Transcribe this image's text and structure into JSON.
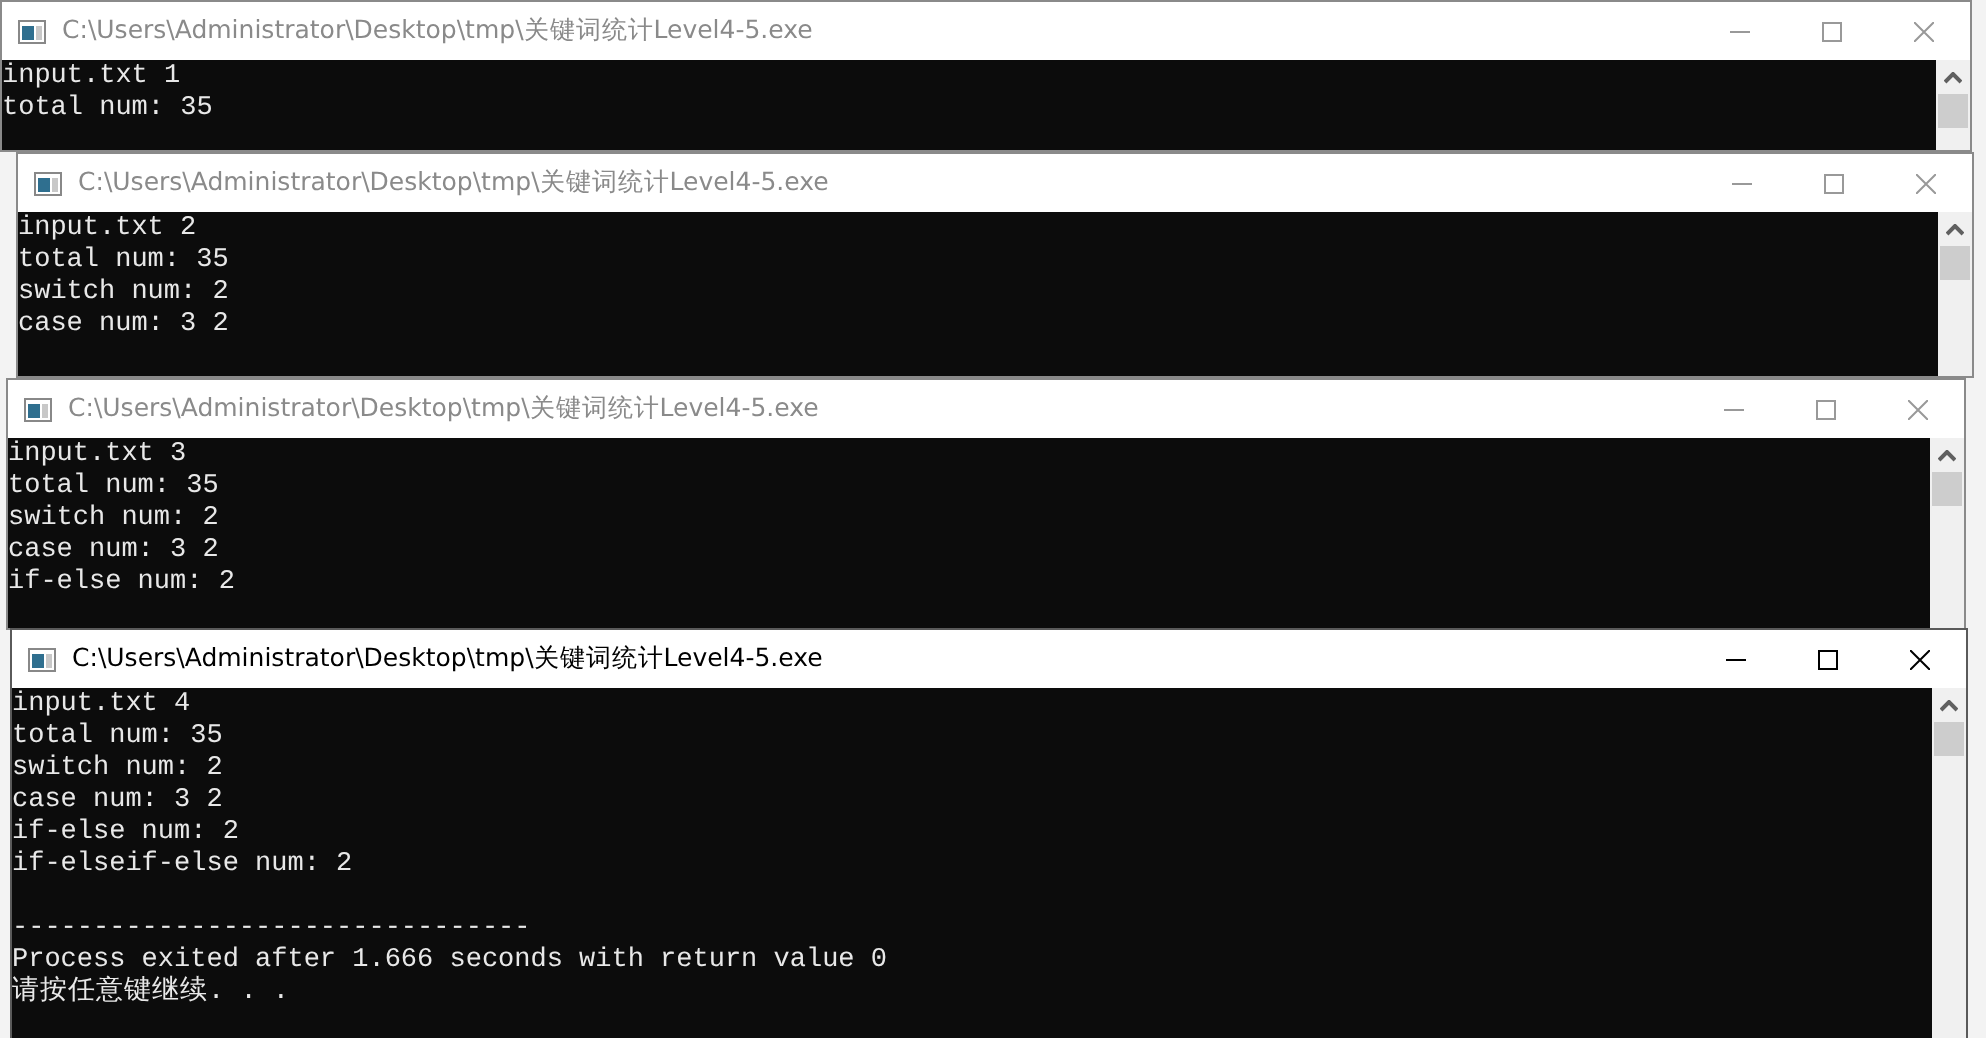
{
  "windows": [
    {
      "title": "C:\\Users\\Administrator\\Desktop\\tmp\\关键词统计Level4-5.exe",
      "active": false,
      "lines": [
        {
          "text": "input.txt 1"
        },
        {
          "text": "total num: 35"
        }
      ]
    },
    {
      "title": "C:\\Users\\Administrator\\Desktop\\tmp\\关键词统计Level4-5.exe",
      "active": false,
      "lines": [
        {
          "text": "input.txt 2"
        },
        {
          "text": "total num: 35"
        },
        {
          "text": "switch num: 2"
        },
        {
          "text": "case num: 3 2"
        }
      ]
    },
    {
      "title": "C:\\Users\\Administrator\\Desktop\\tmp\\关键词统计Level4-5.exe",
      "active": false,
      "lines": [
        {
          "text": "input.txt 3"
        },
        {
          "text": "total num: 35"
        },
        {
          "text": "switch num: 2"
        },
        {
          "text": "case num: 3 2"
        },
        {
          "text": "if-else num: 2"
        }
      ]
    },
    {
      "title": "C:\\Users\\Administrator\\Desktop\\tmp\\关键词统计Level4-5.exe",
      "active": true,
      "lines": [
        {
          "text": "input.txt 4"
        },
        {
          "text": "total num: 35"
        },
        {
          "text": "switch num: 2"
        },
        {
          "text": "case num: 3 2"
        },
        {
          "text": "if-else num: 2"
        },
        {
          "text": "if-elseif-else num: 2"
        },
        {
          "text": "--------------------------------",
          "spaced": true
        },
        {
          "text": "Process exited after 1.666 seconds with return value 0"
        },
        {
          "text": "请按任意键继续. . ."
        }
      ]
    }
  ]
}
